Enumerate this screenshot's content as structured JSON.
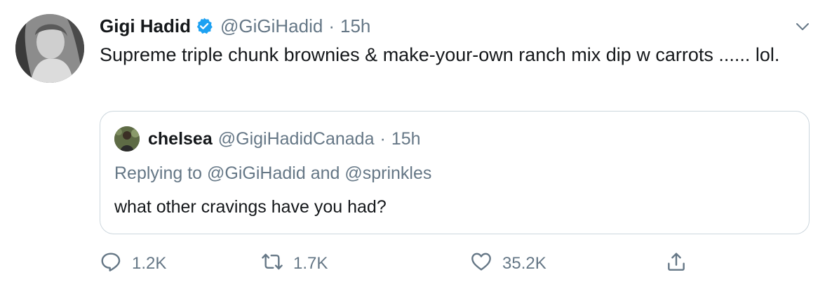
{
  "tweet": {
    "display_name": "Gigi Hadid",
    "handle": "@GiGiHadid",
    "separator": "·",
    "time": "15h",
    "text": "Supreme triple chunk brownies & make-your-own ranch mix dip w carrots ...... lol.",
    "verified": true
  },
  "quote": {
    "display_name": "chelsea",
    "handle": "@GigiHadidCanada",
    "separator": "·",
    "time": "15h",
    "reply_prefix": "Replying to",
    "reply_mention_1": "@GiGiHadid",
    "reply_and": "and",
    "reply_mention_2": "@sprinkles",
    "text": "what other cravings have you had?"
  },
  "actions": {
    "reply_count": "1.2K",
    "retweet_count": "1.7K",
    "like_count": "35.2K"
  },
  "icons": {
    "reply": "comment-icon",
    "retweet": "retweet-icon",
    "like": "heart-icon",
    "share": "share-icon",
    "menu": "chevron-down-icon",
    "verified": "verified-badge-icon"
  },
  "colors": {
    "text_primary": "#14171a",
    "text_secondary": "#657786",
    "verified_blue": "#1da1f2",
    "border": "#ccd6dd"
  }
}
